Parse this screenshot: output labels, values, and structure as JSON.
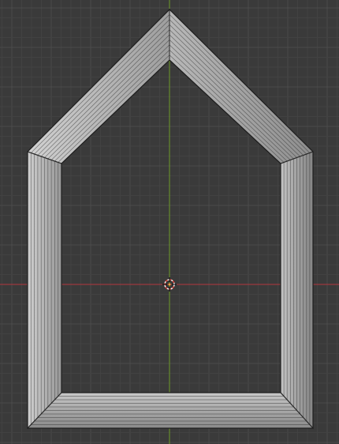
{
  "viewport": {
    "background_color": "#3a3a3a",
    "grid_minor_color": "#424242",
    "grid_major_color": "#4b4b4b",
    "x_axis_color": "#b2363e",
    "y_axis_color": "#6e9a28",
    "mesh_light": "#c9c9c9",
    "mesh_mid": "#a8a8a8",
    "mesh_dark": "#8d8d8d",
    "edge_color": "#2a2a2a",
    "object": "house-shaped-frame",
    "cursor": "3d-cursor"
  }
}
